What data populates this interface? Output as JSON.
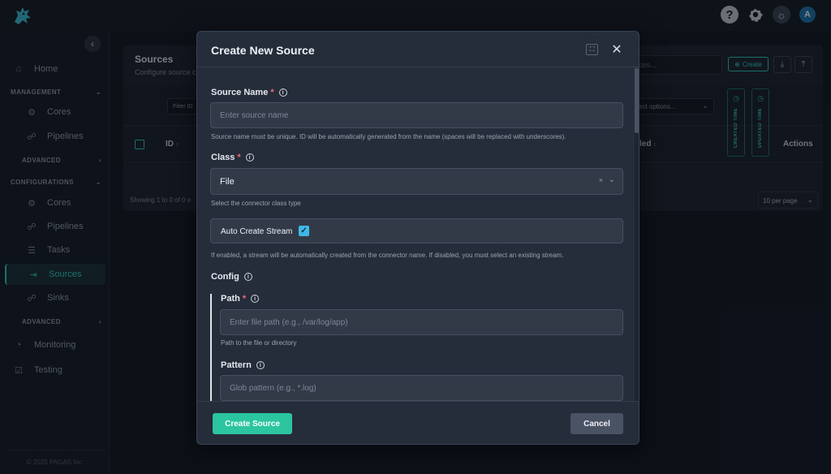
{
  "topbar": {
    "help_icon": "question-circle-icon",
    "settings_icon": "gear-icon",
    "theme_icon": "sun-icon",
    "avatar_initial": "A"
  },
  "sidebar": {
    "collapse_icon": "chevron-left-icon",
    "home": "Home",
    "management_section": "MANAGEMENT",
    "management_items": [
      "Cores",
      "Pipelines"
    ],
    "advanced_1": "ADVANCED",
    "configurations_section": "CONFIGURATIONS",
    "configurations_items": [
      "Cores",
      "Pipelines",
      "Tasks",
      "Sources",
      "Sinks"
    ],
    "advanced_2": "ADVANCED",
    "monitoring": "Monitoring",
    "testing": "Testing",
    "copyright": "© 2025 PAGAS Inc."
  },
  "page": {
    "title": "Sources",
    "subtitle": "Configure source c",
    "search_placeholder": "urces...",
    "create_label": "Create",
    "filter_placeholder": "Filter ID",
    "select_placeholder": "ect options...",
    "col_id": "ID",
    "col_enabled": "led",
    "col_created": "CREATED TIME",
    "col_updated": "UPDATED TIME",
    "col_actions": "Actions",
    "showing": "Showing 1 to 0 of 0 e",
    "per_page": "10 per page"
  },
  "modal": {
    "title": "Create New Source",
    "source_name": {
      "label": "Source Name",
      "placeholder": "Enter source name",
      "help": "Source name must be unique. ID will be automatically generated from the name (spaces will be replaced with underscores)."
    },
    "class": {
      "label": "Class",
      "value": "File",
      "help": "Select the connector class type"
    },
    "auto_create": {
      "label": "Auto Create Stream",
      "checked": true,
      "help": "If enabled, a stream will be automatically created from the connector name. If disabled, you must select an existing stream."
    },
    "config": {
      "label": "Config",
      "path": {
        "label": "Path",
        "placeholder": "Enter file path (e.g., /var/log/app)",
        "help": "Path to the file or directory"
      },
      "pattern": {
        "label": "Pattern",
        "placeholder": "Glob pattern (e.g., *.log)"
      }
    },
    "submit_label": "Create Source",
    "cancel_label": "Cancel"
  },
  "colors": {
    "accent": "#2ec5b6",
    "primary_button": "#2bc5a0",
    "required": "#f06a7a",
    "checkbox": "#3fb8e8"
  }
}
